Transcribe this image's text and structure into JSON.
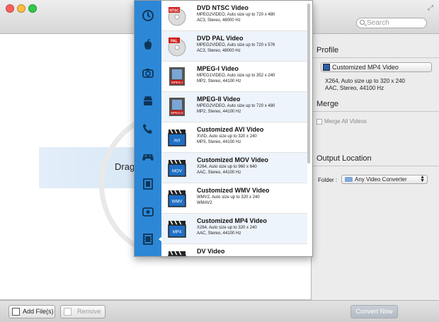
{
  "window": {
    "title": "",
    "search_placeholder": "Search"
  },
  "drop_zone": {
    "prompt": "Drag"
  },
  "profile": {
    "heading": "Profile",
    "selected": "Customized MP4 Video",
    "details_line1": "X264, Auto size up to 320 x 240",
    "details_line2": "AAC, Stereo, 44100 Hz"
  },
  "merge": {
    "heading": "Merge",
    "checkbox_label": "Merge All Videos",
    "checked": false
  },
  "output": {
    "heading": "Output Location",
    "folder_label": "Folder :",
    "folder_value": "Any Video Converter"
  },
  "bottom": {
    "add_label": "Add File(s)",
    "remove_label": "Remove",
    "convert_label": "Convert Now"
  },
  "categories": [
    {
      "icon": "clock-icon",
      "selected": false
    },
    {
      "icon": "apple-icon",
      "selected": false
    },
    {
      "icon": "camera-icon",
      "selected": false
    },
    {
      "icon": "android-icon",
      "selected": false
    },
    {
      "icon": "phone-icon",
      "selected": false
    },
    {
      "icon": "gamepad-icon",
      "selected": false
    },
    {
      "icon": "film-icon",
      "selected": false
    },
    {
      "icon": "photo-icon",
      "selected": false
    },
    {
      "icon": "video-file-icon",
      "selected": true
    }
  ],
  "formats": [
    {
      "name": "DVD NTSC Video",
      "desc1": "MPEG2VIDEO, Auto size up to 720 x 480",
      "desc2": "AC3, Stereo, 48000 Hz",
      "desc3": "",
      "thumb": "dvd",
      "badge": "NTSC"
    },
    {
      "name": "DVD PAL Video",
      "desc1": "MPEG2VIDEO, Auto size up to 720 x 576",
      "desc2": "AC3, Stereo, 48000 Hz",
      "desc3": "",
      "thumb": "dvd",
      "badge": "PAL"
    },
    {
      "name": "MPEG-I Video",
      "desc1": "MPEG1VIDEO, Auto size up to 352 x 240",
      "desc2": "MP2, Stereo, 44100 Hz",
      "desc3": "",
      "thumb": "film",
      "badge": "MPEG-I"
    },
    {
      "name": "MPEG-II Video",
      "desc1": "MPEG2VIDEO, Auto size up to 720 x 480",
      "desc2": "MP2, Stereo, 44100 Hz",
      "desc3": "",
      "thumb": "film",
      "badge": "MPEG-II"
    },
    {
      "name": "Customized AVI Video",
      "desc1": "XVID, Auto size up to 320 x 240",
      "desc2": "MP3, Stereo, 44100 Hz",
      "desc3": "",
      "thumb": "clap",
      "badge": "AVI"
    },
    {
      "name": "Customized MOV Video",
      "desc1": "X264, Auto size up to 960 x 640",
      "desc2": "AAC, Stereo, 44100 Hz",
      "desc3": "",
      "thumb": "clap",
      "badge": "MOV"
    },
    {
      "name": "Customized WMV Video",
      "desc1": "WMV2, Auto size up to 320 x 240",
      "desc2": "WMAV2",
      "desc3": "",
      "thumb": "clap",
      "badge": "WMV"
    },
    {
      "name": "Customized MP4 Video",
      "desc1": "X264, Auto size up to 320 x 240",
      "desc2": "AAC, Stereo, 44100 Hz",
      "desc3": "",
      "thumb": "clap",
      "badge": "MP4"
    },
    {
      "name": "DV Video",
      "desc1": "",
      "desc2": "",
      "desc3": "",
      "thumb": "clap",
      "badge": ""
    }
  ],
  "colors": {
    "sidebar_blue": "#2c88d6",
    "row_alt": "#eef4fb",
    "clapper_blue": "#1f6fc5"
  }
}
